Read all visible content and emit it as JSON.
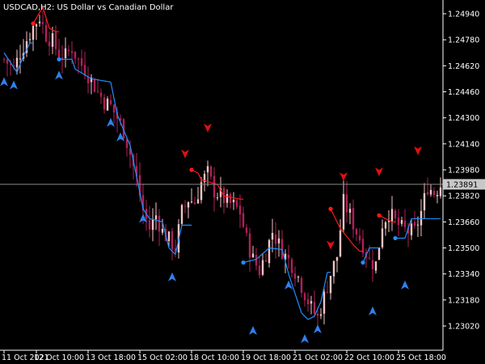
{
  "chart_title": {
    "symbol": "USDCAD",
    "timeframe": "H2",
    "description": "US Dollar vs Canadian Dollar"
  },
  "current_price_label": "1.23891",
  "colors": {
    "background": "#000000",
    "grid": "#3a3a3a",
    "axis_text": "#ffffff",
    "bull_candle": "#f2c4c4",
    "bear_candle": "#b0205a",
    "trail_up_line": "#1e90ff",
    "trail_down_line": "#ff1a1a",
    "buy_arrow": "#2f80ed",
    "sell_arrow": "#e01010",
    "price_line": "#8a8a8a",
    "price_badge_bg": "#c8c8c8"
  },
  "chart_data": {
    "type": "candlestick",
    "title": "USDCAD,H2: US Dollar vs Canadian Dollar",
    "ylim": [
      1.2294,
      1.2505
    ],
    "y_ticks": [
      1.2494,
      1.2478,
      1.2462,
      1.2446,
      1.243,
      1.2414,
      1.2398,
      1.2382,
      1.2366,
      1.235,
      1.2334,
      1.2318,
      1.2302
    ],
    "y_tick_labels": [
      "1.24940",
      "1.24780",
      "1.24620",
      "1.24460",
      "1.24300",
      "1.24140",
      "1.23980",
      "1.23820",
      "1.23660",
      "1.23500",
      "1.23340",
      "1.23180",
      "1.23020"
    ],
    "x_tick_labels": [
      {
        "label": "11 Oct 2021",
        "index": 0
      },
      {
        "label": "12 Oct 10:00",
        "index": 10
      },
      {
        "label": "13 Oct 18:00",
        "index": 26
      },
      {
        "label": "15 Oct 02:00",
        "index": 42
      },
      {
        "label": "18 Oct 10:00",
        "index": 58
      },
      {
        "label": "19 Oct 18:00",
        "index": 74
      },
      {
        "label": "21 Oct 02:00",
        "index": 90
      },
      {
        "label": "22 Oct 10:00",
        "index": 106
      },
      {
        "label": "25 Oct 18:00",
        "index": 122
      }
    ],
    "candle_count": 136,
    "current_price": 1.23891,
    "price_anchors": [
      [
        0,
        1.2466
      ],
      [
        3,
        1.246
      ],
      [
        5,
        1.247
      ],
      [
        9,
        1.2486
      ],
      [
        11,
        1.2492
      ],
      [
        13,
        1.2481
      ],
      [
        15,
        1.2477
      ],
      [
        17,
        1.2469
      ],
      [
        19,
        1.2468
      ],
      [
        21,
        1.2473
      ],
      [
        23,
        1.2465
      ],
      [
        25,
        1.246
      ],
      [
        27,
        1.2453
      ],
      [
        29,
        1.2446
      ],
      [
        31,
        1.244
      ],
      [
        33,
        1.2437
      ],
      [
        35,
        1.243
      ],
      [
        37,
        1.2422
      ],
      [
        39,
        1.2408
      ],
      [
        41,
        1.2392
      ],
      [
        43,
        1.2373
      ],
      [
        45,
        1.2362
      ],
      [
        47,
        1.237
      ],
      [
        49,
        1.236
      ],
      [
        51,
        1.2355
      ],
      [
        53,
        1.235
      ],
      [
        55,
        1.2372
      ],
      [
        57,
        1.238
      ],
      [
        59,
        1.2378
      ],
      [
        61,
        1.239
      ],
      [
        63,
        1.2396
      ],
      [
        65,
        1.2385
      ],
      [
        67,
        1.2382
      ],
      [
        69,
        1.2378
      ],
      [
        71,
        1.2376
      ],
      [
        73,
        1.2372
      ],
      [
        75,
        1.2355
      ],
      [
        77,
        1.2343
      ],
      [
        79,
        1.2336
      ],
      [
        81,
        1.2347
      ],
      [
        83,
        1.236
      ],
      [
        85,
        1.2352
      ],
      [
        87,
        1.2345
      ],
      [
        89,
        1.234
      ],
      [
        91,
        1.2332
      ],
      [
        93,
        1.2322
      ],
      [
        95,
        1.2313
      ],
      [
        97,
        1.2307
      ],
      [
        99,
        1.232
      ],
      [
        101,
        1.2334
      ],
      [
        103,
        1.2345
      ],
      [
        105,
        1.2378
      ],
      [
        107,
        1.237
      ],
      [
        109,
        1.236
      ],
      [
        111,
        1.2352
      ],
      [
        113,
        1.2342
      ],
      [
        115,
        1.234
      ],
      [
        117,
        1.2365
      ],
      [
        119,
        1.2372
      ],
      [
        121,
        1.2366
      ],
      [
        123,
        1.2362
      ],
      [
        125,
        1.236
      ],
      [
        127,
        1.236
      ],
      [
        129,
        1.2372
      ],
      [
        131,
        1.2388
      ],
      [
        133,
        1.2384
      ],
      [
        135,
        1.2389
      ]
    ],
    "trailing_stop": [
      {
        "index": 0,
        "value": 1.247,
        "trend": "up"
      },
      {
        "index": 4,
        "value": 1.2458,
        "trend": "up"
      },
      {
        "index": 6,
        "value": 1.2468,
        "trend": "up"
      },
      {
        "index": 8,
        "value": 1.2476,
        "trend": "up"
      },
      {
        "index": 9,
        "value": 1.2488,
        "trend": "down"
      },
      {
        "index": 12,
        "value": 1.2498,
        "trend": "down"
      },
      {
        "index": 14,
        "value": 1.2485,
        "trend": "down"
      },
      {
        "index": 16,
        "value": 1.2483,
        "trend": "down"
      },
      {
        "index": 17,
        "value": 1.2466,
        "trend": "up"
      },
      {
        "index": 21,
        "value": 1.2466,
        "trend": "up"
      },
      {
        "index": 22,
        "value": 1.246,
        "trend": "up"
      },
      {
        "index": 27,
        "value": 1.2454,
        "trend": "up"
      },
      {
        "index": 33,
        "value": 1.2452,
        "trend": "up"
      },
      {
        "index": 35,
        "value": 1.2432,
        "trend": "up"
      },
      {
        "index": 39,
        "value": 1.2413,
        "trend": "up"
      },
      {
        "index": 41,
        "value": 1.2394,
        "trend": "up"
      },
      {
        "index": 43,
        "value": 1.2374,
        "trend": "up"
      },
      {
        "index": 45,
        "value": 1.2368,
        "trend": "up"
      },
      {
        "index": 49,
        "value": 1.2366,
        "trend": "up"
      },
      {
        "index": 51,
        "value": 1.235,
        "trend": "up"
      },
      {
        "index": 53,
        "value": 1.2346,
        "trend": "up"
      },
      {
        "index": 55,
        "value": 1.2364,
        "trend": "up"
      },
      {
        "index": 57,
        "value": 1.2364,
        "trend": "up"
      },
      {
        "index": 58,
        "value": 1.2398,
        "trend": "down"
      },
      {
        "index": 60,
        "value": 1.2396,
        "trend": "down"
      },
      {
        "index": 61,
        "value": 1.2392,
        "trend": "down"
      },
      {
        "index": 66,
        "value": 1.2389,
        "trend": "down"
      },
      {
        "index": 68,
        "value": 1.2382,
        "trend": "down"
      },
      {
        "index": 73,
        "value": 1.238,
        "trend": "down"
      },
      {
        "index": 74,
        "value": 1.2341,
        "trend": "up"
      },
      {
        "index": 78,
        "value": 1.2343,
        "trend": "up"
      },
      {
        "index": 82,
        "value": 1.235,
        "trend": "up"
      },
      {
        "index": 86,
        "value": 1.2349,
        "trend": "up"
      },
      {
        "index": 88,
        "value": 1.2334,
        "trend": "up"
      },
      {
        "index": 90,
        "value": 1.2322,
        "trend": "up"
      },
      {
        "index": 92,
        "value": 1.231,
        "trend": "up"
      },
      {
        "index": 94,
        "value": 1.2306,
        "trend": "up"
      },
      {
        "index": 96,
        "value": 1.2308,
        "trend": "up"
      },
      {
        "index": 98,
        "value": 1.2317,
        "trend": "up"
      },
      {
        "index": 100,
        "value": 1.2335,
        "trend": "up"
      },
      {
        "index": 101,
        "value": 1.2374,
        "trend": "down"
      },
      {
        "index": 104,
        "value": 1.2362,
        "trend": "down"
      },
      {
        "index": 108,
        "value": 1.2352,
        "trend": "down"
      },
      {
        "index": 110,
        "value": 1.2348,
        "trend": "down"
      },
      {
        "index": 111,
        "value": 1.2341,
        "trend": "up"
      },
      {
        "index": 113,
        "value": 1.235,
        "trend": "up"
      },
      {
        "index": 116,
        "value": 1.237,
        "trend": "down"
      },
      {
        "index": 120,
        "value": 1.2366,
        "trend": "down"
      },
      {
        "index": 121,
        "value": 1.2356,
        "trend": "up"
      },
      {
        "index": 124,
        "value": 1.2356,
        "trend": "up"
      },
      {
        "index": 126,
        "value": 1.2368,
        "trend": "up"
      },
      {
        "index": 135,
        "value": 1.2368,
        "trend": "up"
      }
    ],
    "buy_arrows": [
      {
        "index": 0,
        "value": 1.2452
      },
      {
        "index": 3,
        "value": 1.245
      },
      {
        "index": 17,
        "value": 1.2456
      },
      {
        "index": 33,
        "value": 1.2427
      },
      {
        "index": 36,
        "value": 1.2418
      },
      {
        "index": 43,
        "value": 1.2368
      },
      {
        "index": 52,
        "value": 1.2332
      },
      {
        "index": 77,
        "value": 1.2299
      },
      {
        "index": 88,
        "value": 1.2327
      },
      {
        "index": 93,
        "value": 1.2294
      },
      {
        "index": 97,
        "value": 1.23
      },
      {
        "index": 114,
        "value": 1.2311
      },
      {
        "index": 124,
        "value": 1.2327
      }
    ],
    "sell_arrows": [
      {
        "index": 63,
        "value": 1.2424
      },
      {
        "index": 56,
        "value": 1.2408
      },
      {
        "index": 101,
        "value": 1.2352
      },
      {
        "index": 105,
        "value": 1.2394
      },
      {
        "index": 116,
        "value": 1.2397
      },
      {
        "index": 128,
        "value": 1.241
      }
    ]
  }
}
